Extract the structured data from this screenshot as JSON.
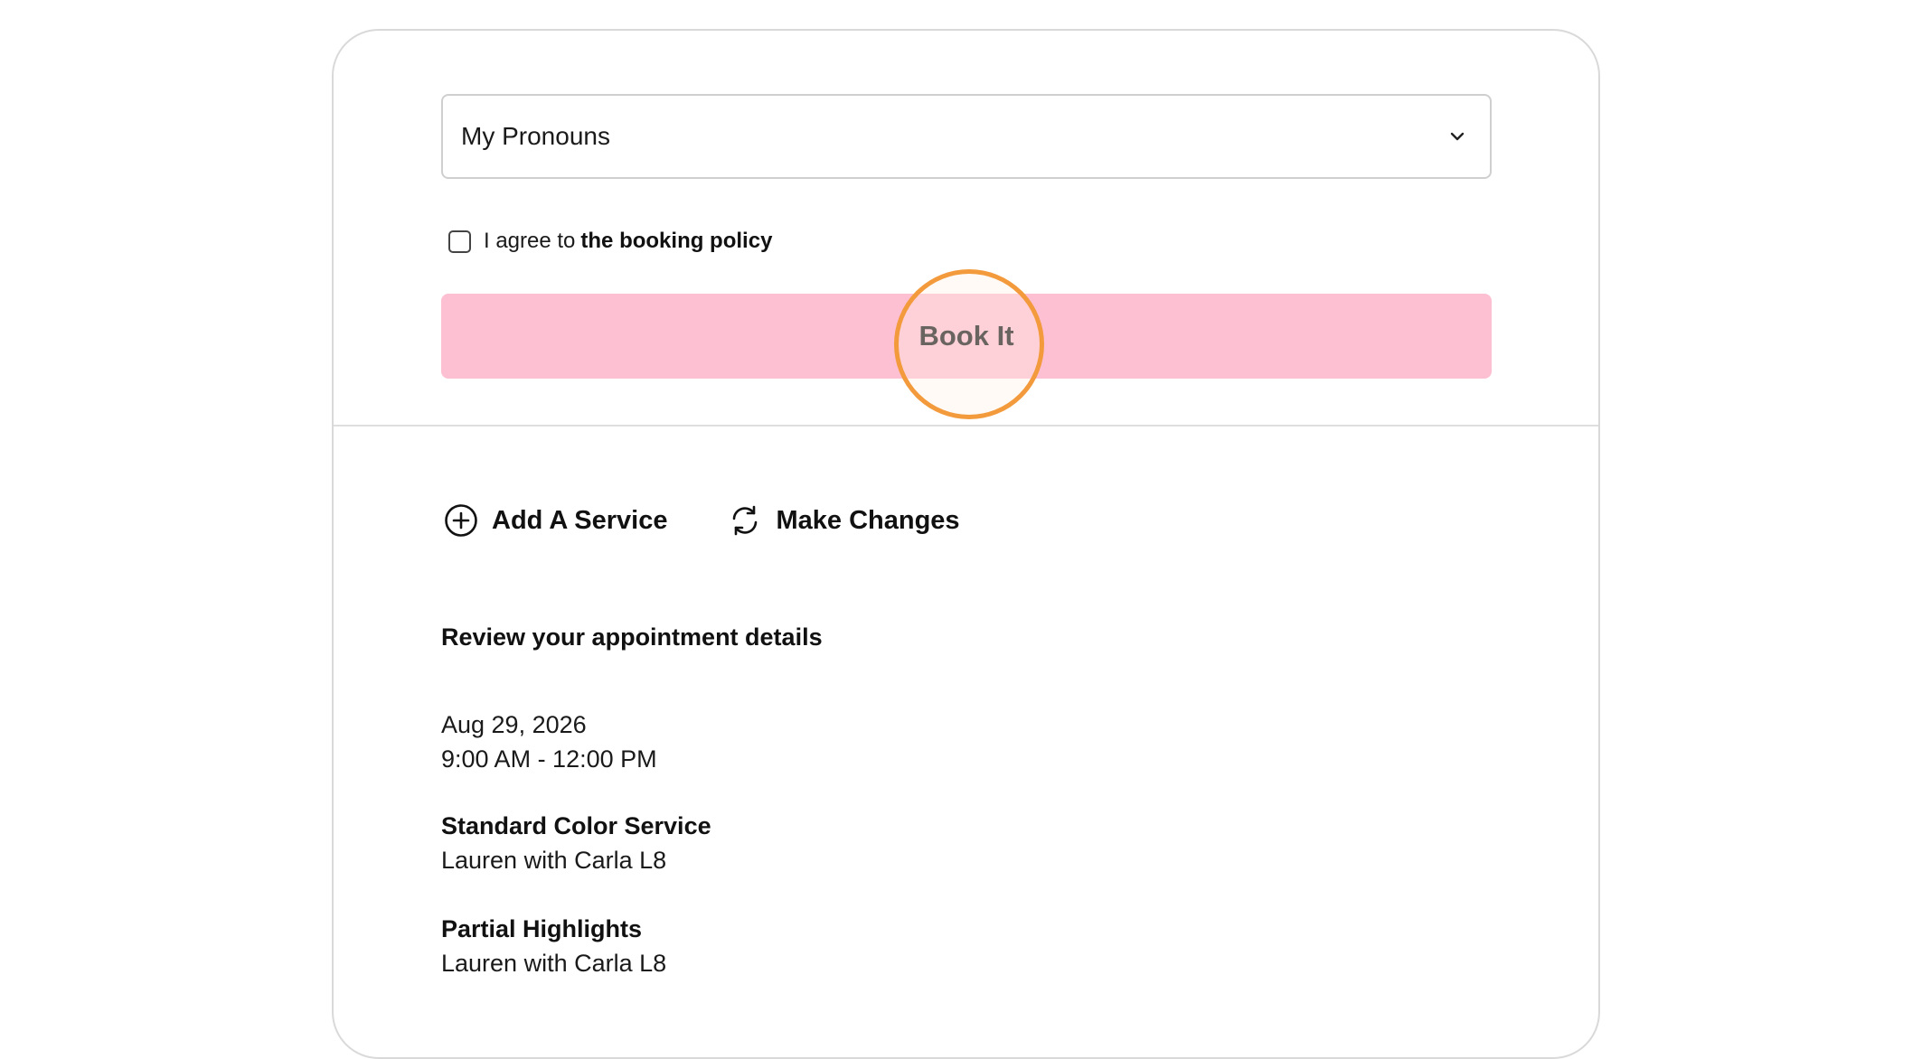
{
  "form": {
    "pronouns_select": {
      "value": "My Pronouns"
    },
    "agree": {
      "prefix": "I agree to",
      "link": "the booking policy",
      "checked": false
    },
    "book_button": {
      "label": "Book It"
    }
  },
  "actions": {
    "add_service": "Add A Service",
    "make_changes": "Make Changes"
  },
  "review": {
    "title": "Review your appointment details",
    "date": "Aug 29, 2026",
    "time": "9:00 AM - 12:00 PM",
    "services": [
      {
        "name": "Standard Color Service",
        "staff": "Lauren with Carla L8"
      },
      {
        "name": "Partial Highlights",
        "staff": "Lauren with Carla L8"
      }
    ]
  },
  "colors": {
    "book_button_bg": "#fdbfd2",
    "highlight_ring": "#f39a3c"
  },
  "icons": [
    "chevron-down-icon",
    "plus-circle-icon",
    "refresh-icon"
  ]
}
